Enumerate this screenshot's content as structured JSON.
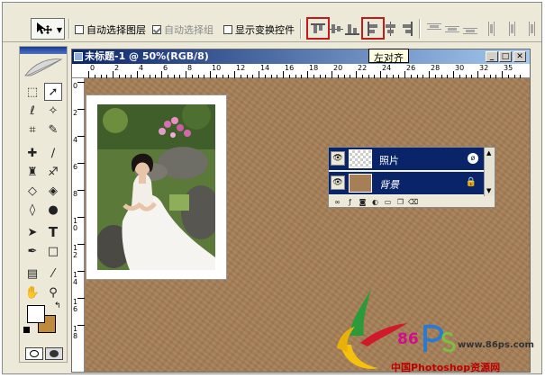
{
  "options_bar": {
    "auto_select_layer": "自动选择图层",
    "auto_select_group": "自动选择组",
    "show_transform_controls": "显示变换控件",
    "tooltip": "左对齐"
  },
  "document": {
    "title": "未标题-1 @ 50%(RGB/8)",
    "ruler_top": [
      "0",
      "2",
      "4",
      "6",
      "8",
      "10",
      "12",
      "14",
      "16",
      "18",
      "20",
      "22",
      "24",
      "26",
      "28",
      "30",
      "32",
      "35"
    ],
    "ruler_left": [
      "0",
      "2",
      "4",
      "6",
      "8",
      "1\n0",
      "1\n2",
      "1\n4",
      "1\n6",
      "1\n8"
    ]
  },
  "layers": [
    {
      "name": "照片",
      "selected": true
    },
    {
      "name": "背景",
      "selected": true,
      "locked": true
    }
  ],
  "watermark": {
    "number": "86",
    "url": "www.86ps.com",
    "site": "中国Photoshop资源网"
  },
  "colors": {
    "canvas": "#a67f57",
    "selection_blue": "#0a246a",
    "highlight_red": "#c21b1b",
    "background_swatch": "#c08a3c"
  },
  "icons": [
    "move-tool-icon",
    "align-left-icon",
    "eye-icon",
    "lock-icon",
    "link-icon",
    "feather-icon"
  ]
}
